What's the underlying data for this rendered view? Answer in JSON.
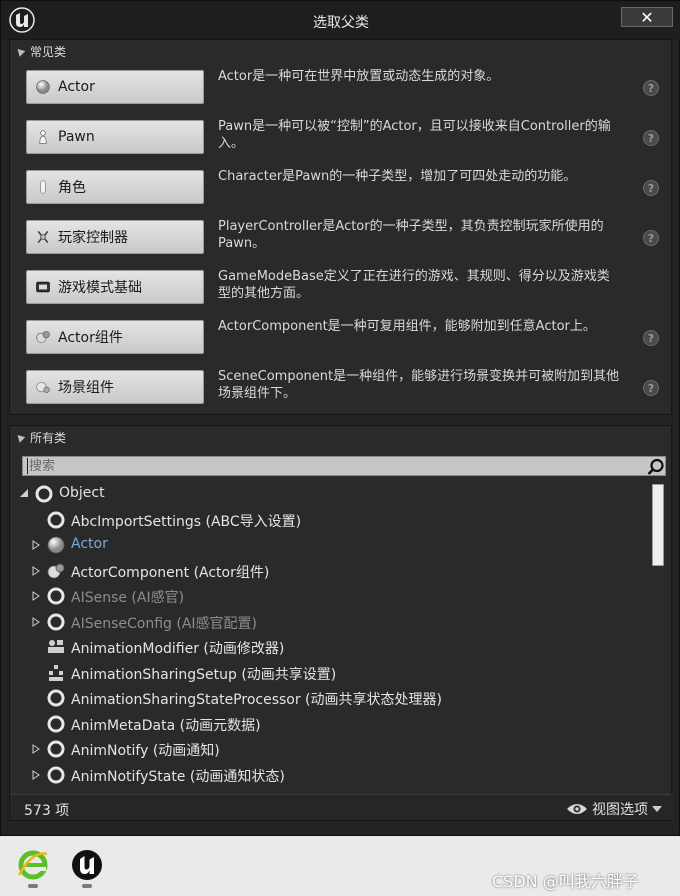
{
  "window": {
    "title": "选取父类",
    "close_label": "✕"
  },
  "common": {
    "header": "常见类",
    "items": [
      {
        "label": "Actor",
        "desc": "Actor是一种可在世界中放置或动态生成的对象。",
        "icon": "sphere-icon"
      },
      {
        "label": "Pawn",
        "desc": "Pawn是一种可以被“控制”的Actor，且可以接收来自Controller的输入。",
        "icon": "pawn-icon"
      },
      {
        "label": "角色",
        "desc": "Character是Pawn的一种子类型，增加了可四处走动的功能。",
        "icon": "character-icon"
      },
      {
        "label": "玩家控制器",
        "desc": "PlayerController是Actor的一种子类型，其负责控制玩家所使用的Pawn。",
        "icon": "player-controller-icon"
      },
      {
        "label": "游戏模式基础",
        "desc": "GameModeBase定义了正在进行的游戏、其规则、得分以及游戏类型的其他方面。",
        "icon": "game-mode-icon"
      },
      {
        "label": "Actor组件",
        "desc": "ActorComponent是一种可复用组件，能够附加到任意Actor上。",
        "icon": "actor-component-icon"
      },
      {
        "label": "场景组件",
        "desc": "SceneComponent是一种组件，能够进行场景变换并可被附加到其他场景组件下。",
        "icon": "scene-component-icon"
      }
    ],
    "help_glyph": "?"
  },
  "all": {
    "header": "所有类",
    "search_placeholder": "搜索",
    "tree": [
      {
        "label": "Object",
        "level": 0,
        "expander": "open",
        "icon": "class-ring-icon",
        "style": "normal"
      },
      {
        "label": "AbcImportSettings (ABC导入设置)",
        "level": 1,
        "expander": "none",
        "icon": "class-ring-icon",
        "style": "normal"
      },
      {
        "label": "Actor",
        "level": 1,
        "expander": "closed",
        "icon": "sphere-icon",
        "style": "link"
      },
      {
        "label": "ActorComponent (Actor组件)",
        "level": 1,
        "expander": "closed",
        "icon": "actor-component-icon",
        "style": "normal"
      },
      {
        "label": "AISense (AI感官)",
        "level": 1,
        "expander": "closed",
        "icon": "class-ring-icon",
        "style": "dim"
      },
      {
        "label": "AISenseConfig (AI感官配置)",
        "level": 1,
        "expander": "closed",
        "icon": "class-ring-icon",
        "style": "dim"
      },
      {
        "label": "AnimationModifier (动画修改器)",
        "level": 1,
        "expander": "none",
        "icon": "animation-modifier-icon",
        "style": "normal"
      },
      {
        "label": "AnimationSharingSetup (动画共享设置)",
        "level": 1,
        "expander": "none",
        "icon": "animation-sharing-icon",
        "style": "normal"
      },
      {
        "label": "AnimationSharingStateProcessor (动画共享状态处理器)",
        "level": 1,
        "expander": "none",
        "icon": "class-ring-icon",
        "style": "normal"
      },
      {
        "label": "AnimMetaData (动画元数据)",
        "level": 1,
        "expander": "none",
        "icon": "class-ring-icon",
        "style": "normal"
      },
      {
        "label": "AnimNotify (动画通知)",
        "level": 1,
        "expander": "closed",
        "icon": "class-ring-icon",
        "style": "normal"
      },
      {
        "label": "AnimNotifyState (动画通知状态)",
        "level": 1,
        "expander": "closed",
        "icon": "class-ring-icon",
        "style": "normal"
      }
    ],
    "count_label": "573 项",
    "view_options_label": "视图选项"
  },
  "taskbar": {
    "apps": [
      "ie-icon",
      "unreal-icon"
    ]
  },
  "watermark": "CSDN @叫我六胖子"
}
